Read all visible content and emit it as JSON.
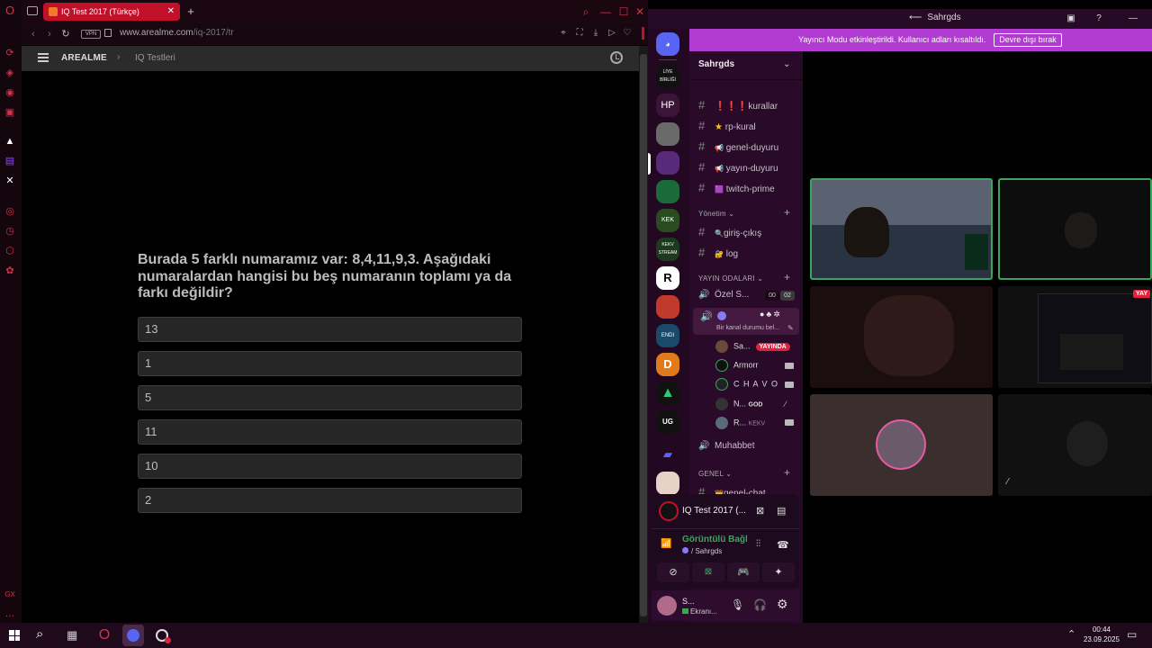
{
  "browser": {
    "tab_title": "IQ Test 2017 (Türkçe)",
    "new_tab": "+",
    "vpn": "VPN",
    "url_host": "www.arealme.com",
    "url_path": "/iq-2017/tr"
  },
  "site": {
    "brand": "AREALME",
    "breadcrumb_sep": "›",
    "breadcrumb": "IQ Testleri"
  },
  "quiz": {
    "question": "Burada 5 farklı numaramız var: 8,4,11,9,3. Aşağıdaki numaralardan hangisi bu beş numaranın toplamı ya da farkı değildir?",
    "answers": [
      "13",
      "1",
      "5",
      "11",
      "10",
      "2"
    ]
  },
  "discord": {
    "window_title": "Sahrgds",
    "banner_text": "Yayıncı Modu etkinleştirildi. Kullanıcı adları kısaltıldı.",
    "banner_button": "Devre dışı bırak",
    "server_name": "Sahrgds",
    "servers": [
      "LİYE BİRLİĞİ",
      "HP",
      "",
      "",
      "",
      "KEK",
      "KEKV STREAM",
      "R",
      "",
      "ENDI",
      "D",
      "",
      "UG",
      ""
    ],
    "channels": [
      {
        "prefix": "❗❗❗",
        "name": "kurallar"
      },
      {
        "prefix": "★",
        "name": "rp-kural"
      },
      {
        "prefix": "📢",
        "name": "genel-duyuru"
      },
      {
        "prefix": "📢",
        "name": "yayın-duyuru"
      },
      {
        "prefix": "🟪",
        "name": "twitch-prime"
      }
    ],
    "cat_yonetim": "Yönetim",
    "yonetim_channels": [
      {
        "prefix": "🔍",
        "name": "giriş-çıkış"
      },
      {
        "prefix": "🔐",
        "name": "log"
      }
    ],
    "cat_yayin": "YAYIN ODALARI",
    "ozel": {
      "name": "Özel S...",
      "count1": "00",
      "count2": "02"
    },
    "active_status": "Bir kanal durumu bel...",
    "voice_users": [
      {
        "name": "Sa...",
        "badge": "YAYINDA"
      },
      {
        "name": "Armorr",
        "badge": ""
      },
      {
        "name": "C H A V O",
        "badge": ""
      },
      {
        "name": "N...",
        "badge": "GOD"
      },
      {
        "name": "R...",
        "badge": "KEKV"
      }
    ],
    "muhabbet": "Muhabbet",
    "cat_genel": "GENEL",
    "genel_chat": "genel-chat",
    "activity_title": "IQ Test 2017 (...",
    "voice_status": "Görüntülü Bağl",
    "voice_channel": "/ Sahrgds",
    "user_short": "S...",
    "user_status": "Ekranı...",
    "live_tile_badge": "YAY"
  },
  "taskbar": {
    "time": "00:44",
    "date": "23.09.2025"
  },
  "colors": {
    "opera_red": "#d2324a",
    "discord_banner": "#b23bd1",
    "speaking_green": "#3ba55d"
  }
}
